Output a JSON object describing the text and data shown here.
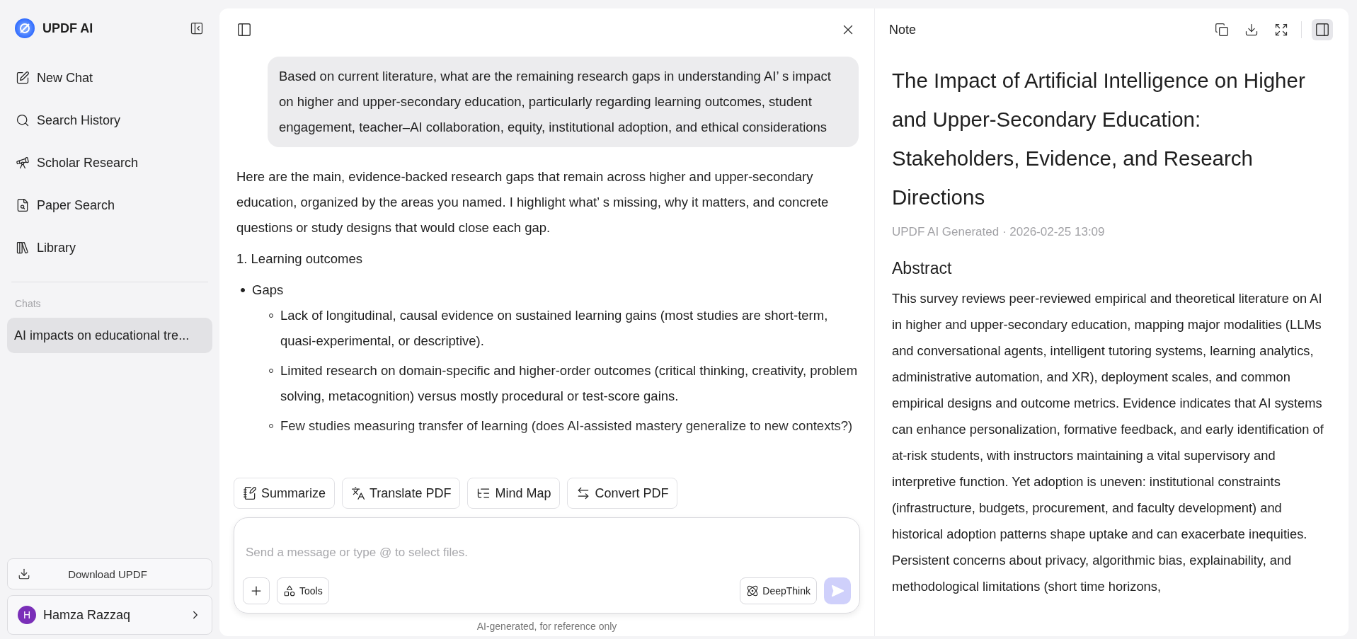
{
  "app": {
    "name": "UPDF AI"
  },
  "sidebar": {
    "items": [
      {
        "label": "New Chat",
        "kind": "new-chat"
      },
      {
        "label": "Search History",
        "kind": "search"
      },
      {
        "label": "Scholar Research",
        "kind": "scholar"
      },
      {
        "label": "Paper Search",
        "kind": "paper"
      },
      {
        "label": "Library",
        "kind": "library"
      }
    ],
    "section_title": "Chats",
    "chats": [
      {
        "title": "AI impacts on educational tre...",
        "selected": true
      }
    ],
    "download_button": "Download UPDF",
    "user": {
      "initial": "H",
      "name": "Hamza Razzaq"
    }
  },
  "chat": {
    "user_message": "Based on current literature, what are the remaining research gaps in understanding AI’ s impact on higher and upper-secondary education, particularly regarding learning outcomes, student engagement, teacher–AI collaboration, equity, institutional adoption, and ethical considerations",
    "reply": {
      "intro": "Here are the main, evidence-backed research gaps that remain across higher and upper-secondary education, organized by the areas you named. I highlight what’ s missing, why it matters, and concrete questions or study designs that would close each gap.",
      "heading": "1. Learning outcomes",
      "bullets": [
        {
          "text": "Gaps",
          "children": [
            {
              "text": "Lack of longitudinal, causal evidence on sustained learning gains (most studies are short-term, quasi-experimental, or descriptive)."
            },
            {
              "text": "Limited research on domain-specific and higher-order outcomes (critical thinking, creativity, problem solving, metacognition) versus mostly procedural or test-score gains."
            },
            {
              "text": "Few studies measuring transfer of learning (does AI-assisted mastery generalize to new contexts?)"
            }
          ]
        }
      ]
    },
    "actions": [
      {
        "label": "Summarize",
        "kind": "summarize"
      },
      {
        "label": "Translate PDF",
        "kind": "translate"
      },
      {
        "label": "Mind Map",
        "kind": "mindmap"
      },
      {
        "label": "Convert PDF",
        "kind": "convert"
      }
    ],
    "composer": {
      "placeholder": "Send a message or type @ to select files.",
      "tools_label": "Tools",
      "deepthink_label": "DeepThink",
      "send_disabled": true
    },
    "disclaimer": "AI-generated, for reference only"
  },
  "note": {
    "title": "Note",
    "heading": "The Impact of Artificial Intelligence on Higher and Upper-Secondary Education: Stakeholders, Evidence, and Research Directions",
    "meta": "UPDF AI Generated · 2026-02-25 13:09",
    "section": "Abstract",
    "body": "This survey reviews peer-reviewed empirical and theoretical literature on AI in higher and upper-secondary education, mapping major modalities (LLMs and conversational agents, intelligent tutoring systems, learning analytics, administrative automation, and XR), deployment scales, and common empirical designs and outcome metrics. Evidence indicates that AI systems can enhance personalization, formative feedback, and early identification of at-risk students, with instructors maintaining a vital supervisory and interpretive function. Yet adoption is uneven: institutional constraints (infrastructure, budgets, procurement, and faculty development) and historical adoption patterns shape uptake and can exacerbate inequities. Persistent concerns about privacy, algorithmic bias, explainability, and methodological limitations (short time horizons,",
    "side_panel_on": true
  }
}
